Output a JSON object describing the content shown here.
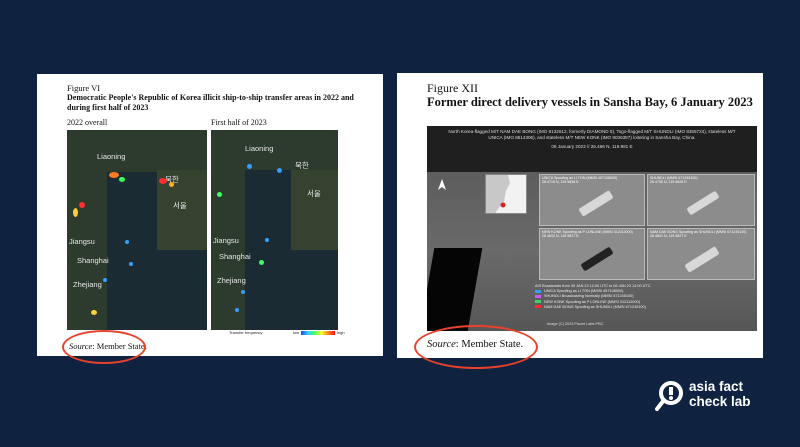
{
  "left_panel": {
    "figure_label": "Figure VI",
    "title": "Democratic People's Republic of Korea illicit ship-to-ship transfer areas in 2022 and during first half of 2023",
    "map_2022_label": "2022 overall",
    "map_2023_label": "First half of 2023",
    "map_place_labels": {
      "liaoning": "Liaoning",
      "korea": "북한",
      "seoul": "서울",
      "jiangsu": "Jiangsu",
      "shanghai": "Shanghai",
      "zhejiang": "Zhejiang"
    },
    "legend": {
      "title": "Transfer frequency",
      "low": "low",
      "high": "high"
    },
    "source_label": "Source",
    "source_value": ": Member State."
  },
  "right_panel": {
    "figure_label": "Figure XII",
    "title": "Former direct delivery vessels in Sansha Bay, 6 January 2023",
    "image_header": "North Korea-flagged M/T NAM DAE BONG (IMO 9132612, formerly DIAMOND 8), Togo-flagged M/T SHUNDLI (IMO 8355724), stateless M/T UNICA (IMO 8514306), and stateless M/T NEW KONK (IMO 9036387) loitering in Sansha Bay, China.",
    "image_date": "06 January 2023 // 26.466 N, 119.981 E",
    "insets": [
      "UNICA Spoofing as LI TON (MMSI 457108000)\n26.4715 N, 119.9838 E",
      "SHUNDLI (MMSI 671245100)\n26.4755 N, 119.9826 E",
      "NEW KONK Spoofing as P LONLINE (MMSI 312112000)\n26.4602 N, 119.9827 E",
      "NAM DAE BONG Spoofing as SHUNDLI (MMSI 671245100)\n26.4602 N, 119.9827 E"
    ],
    "ais_title": "AIS Broadcasts from 05 JAN 23 12:00 UTC to 06 JAN 23 12:00 UTC",
    "ais_entries": [
      "UNICA Spoofing as LI TON (MMSI 457108000)",
      "SHUNDLI Broadcasting Normally (MMSI 671245100)",
      "NEW KONK Spoofing as P LONLINE (MMSI 312112000)",
      "NAM DAE BONG Spoofing as SHUNDLI (MMSI 671245100)"
    ],
    "ais_colors": [
      "#3aa0ff",
      "#c060ff",
      "#40d070",
      "#ff3030"
    ],
    "credit": "Image (C) 2023 Planet Labs PBC",
    "source_label": "Source",
    "source_value": ": Member State."
  },
  "logo": {
    "line1": "asia fact",
    "line2": "check lab"
  },
  "colors": {
    "background": "#0f2240",
    "ring": "#e8412c"
  }
}
